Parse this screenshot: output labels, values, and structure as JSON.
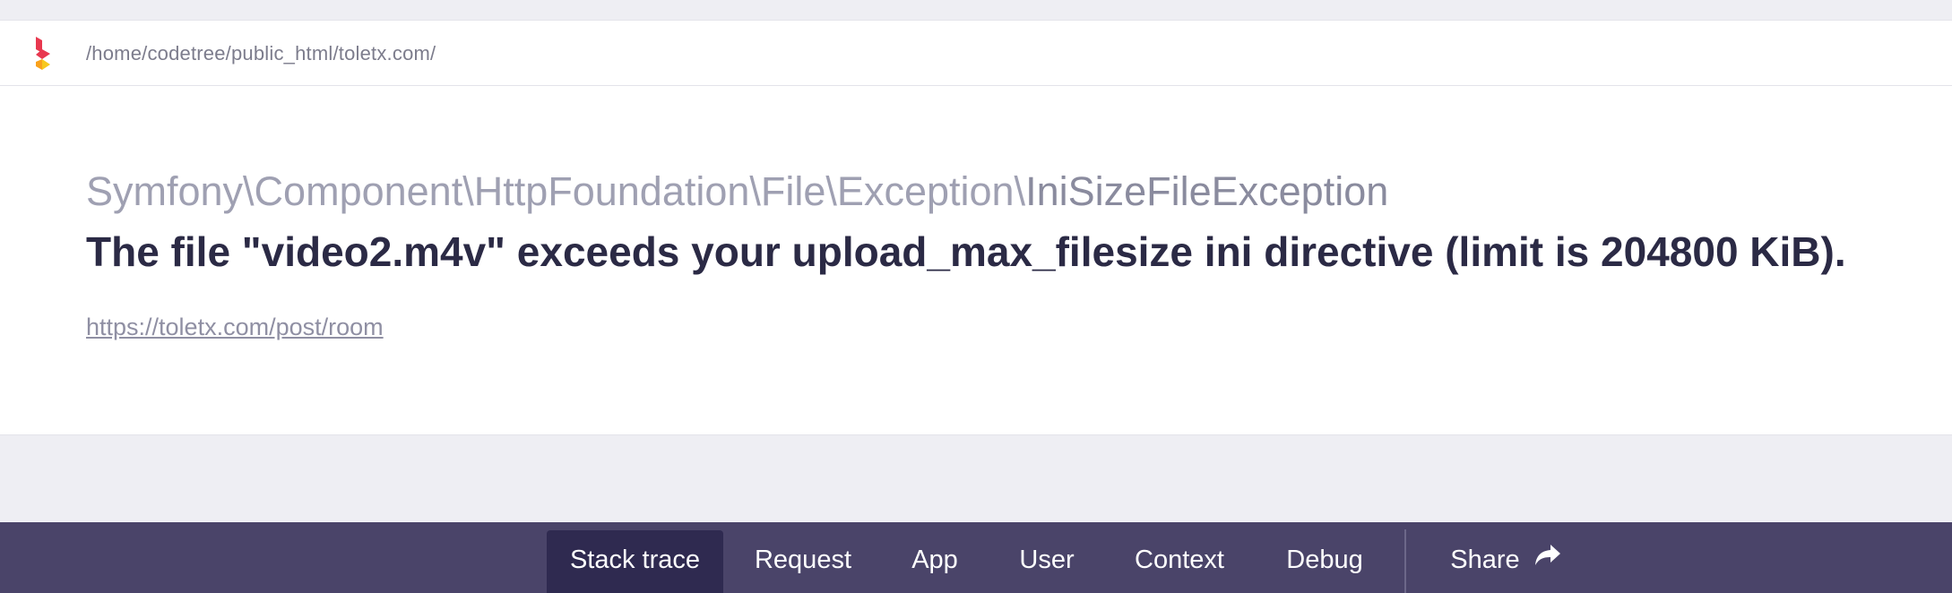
{
  "header": {
    "path": "/home/codetree/public_html/toletx.com/"
  },
  "exception": {
    "namespace": "Symfony\\Component\\HttpFoundation\\File\\Exception\\",
    "class_short": "IniSizeFileException",
    "message": "The file \"video2.m4v\" exceeds your upload_max_filesize ini directive (limit is 204800 KiB).",
    "url": "https://toletx.com/post/room"
  },
  "tabs": {
    "stack_trace": "Stack trace",
    "request": "Request",
    "app": "App",
    "user": "User",
    "context": "Context",
    "debug": "Debug",
    "share": "Share"
  },
  "colors": {
    "tabbar_bg": "#4a4469",
    "tab_active_bg": "#2f2a50",
    "message_text": "#2b2a45",
    "logo_red": "#e8384f",
    "logo_yellow": "#f7c81d"
  },
  "icons": {
    "logo": "ignition-logo",
    "share": "share-arrow-icon"
  }
}
